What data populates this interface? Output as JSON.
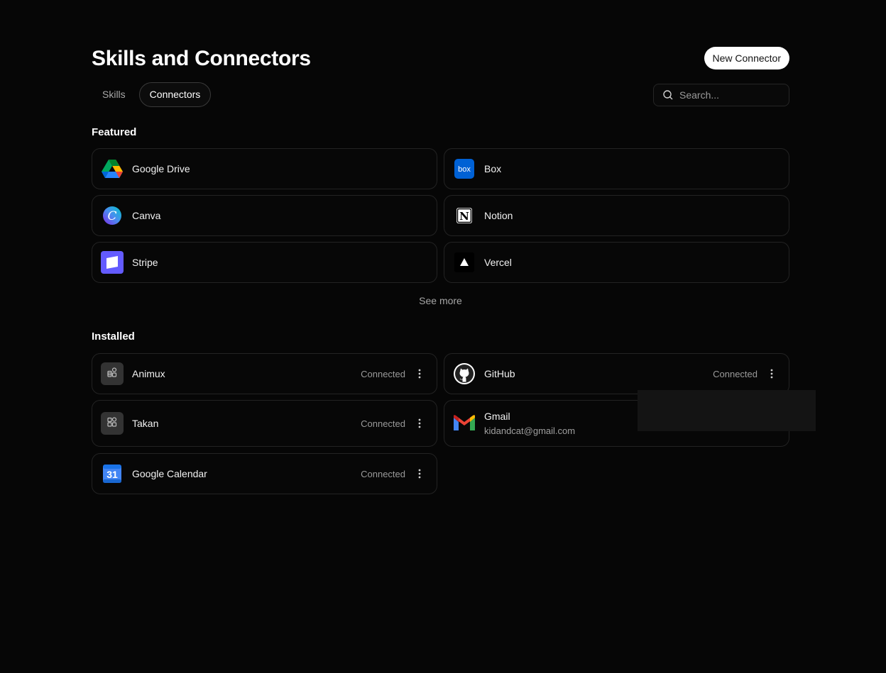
{
  "header": {
    "title": "Skills and Connectors",
    "new_button": "New Connector"
  },
  "tabs": [
    {
      "label": "Skills",
      "active": false
    },
    {
      "label": "Connectors",
      "active": true
    }
  ],
  "search": {
    "placeholder": "Search..."
  },
  "featured": {
    "title": "Featured",
    "items": [
      {
        "name": "Google Drive",
        "icon": "google-drive-icon"
      },
      {
        "name": "Box",
        "icon": "box-icon"
      },
      {
        "name": "Canva",
        "icon": "canva-icon"
      },
      {
        "name": "Notion",
        "icon": "notion-icon"
      },
      {
        "name": "Stripe",
        "icon": "stripe-icon"
      },
      {
        "name": "Vercel",
        "icon": "vercel-icon"
      }
    ],
    "see_more": "See more"
  },
  "installed": {
    "title": "Installed",
    "items": [
      {
        "name": "Animux",
        "status": "Connected",
        "icon": "generic-connector-icon"
      },
      {
        "name": "GitHub",
        "status": "Connected",
        "icon": "github-icon"
      },
      {
        "name": "Takan",
        "status": "Connected",
        "icon": "generic-connector-icon"
      },
      {
        "name": "Gmail",
        "subtitle": "kidandcat@gmail.com",
        "icon": "gmail-icon"
      },
      {
        "name": "Google Calendar",
        "status": "Connected",
        "icon": "google-calendar-icon",
        "icon_text": "31"
      }
    ]
  },
  "colors": {
    "background": "#060606",
    "card_border": "#232323",
    "box_blue": "#0061D5",
    "stripe_purple": "#635BFF"
  }
}
